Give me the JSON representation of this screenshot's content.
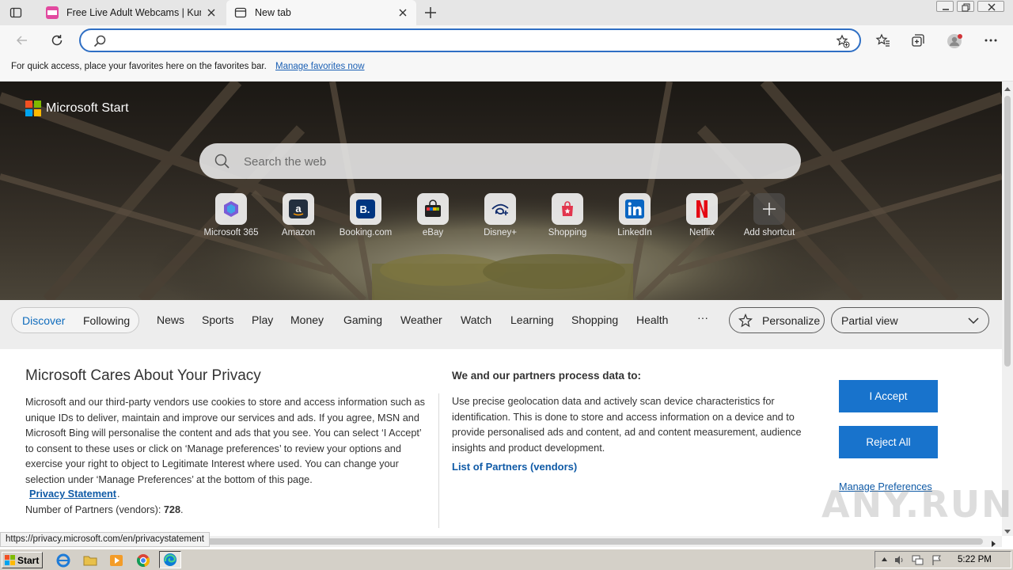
{
  "browser": {
    "tabs": [
      {
        "title": "Free Live Adult Webcams | KumC",
        "active": false
      },
      {
        "title": "New tab",
        "active": true
      }
    ],
    "address": {
      "value": "",
      "placeholder": ""
    },
    "favorites_bar": {
      "text": "For quick access, place your favorites here on the favorites bar.",
      "link": "Manage favorites now"
    },
    "status_url": "https://privacy.microsoft.com/en/privacystatement"
  },
  "page": {
    "brand": "Microsoft Start",
    "search_placeholder": "Search the web",
    "shortcuts": [
      {
        "label": "Microsoft 365",
        "icon": "microsoft-365-icon"
      },
      {
        "label": "Amazon",
        "icon": "amazon-icon"
      },
      {
        "label": "Booking.com",
        "icon": "booking-icon"
      },
      {
        "label": "eBay",
        "icon": "ebay-icon"
      },
      {
        "label": "Disney+",
        "icon": "disney-plus-icon"
      },
      {
        "label": "Shopping",
        "icon": "shopping-icon"
      },
      {
        "label": "LinkedIn",
        "icon": "linkedin-icon"
      },
      {
        "label": "Netflix",
        "icon": "netflix-icon"
      },
      {
        "label": "Add shortcut",
        "icon": "plus-icon"
      }
    ],
    "nav": {
      "discover": "Discover",
      "following": "Following",
      "items": [
        "News",
        "Sports",
        "Play",
        "Money",
        "Gaming",
        "Weather",
        "Watch",
        "Learning",
        "Shopping",
        "Health"
      ],
      "more": "···",
      "personalize": "Personalize",
      "view": "Partial view"
    },
    "consent": {
      "title": "Microsoft Cares About Your Privacy",
      "body": "Microsoft and our third-party vendors use cookies to store and access information such as unique IDs to deliver, maintain and improve our services and ads. If you agree, MSN and Microsoft Bing will personalise the content and ads that you see. You can select ‘I Accept’ to consent to these uses or click on ‘Manage preferences’ to review your options and exercise your right to object to Legitimate Interest where used.  You can change your selection under ‘Manage Preferences’ at the bottom of this page.",
      "privacy_link": "Privacy Statement",
      "privacy_dot": ".",
      "partners_label": "Number of Partners (vendors):",
      "partners_count": "728",
      "partners_dot": ".",
      "subtitle": "We and our partners process data to:",
      "purpose": "Use precise geolocation data and actively scan device characteristics for identification. This is done to store and access information on a device and to provide personalised ads and content, ad and content measurement, audience insights and product development.",
      "vendors_link": "List of Partners (vendors)",
      "accept": "I Accept",
      "reject": "Reject All",
      "manage": "Manage Preferences"
    }
  },
  "watermark": "ANY.RUN",
  "taskbar": {
    "start": "Start",
    "clock": "5:22 PM"
  },
  "colors": {
    "accent": "#1873cc",
    "link": "#0f5aa6",
    "discover": "#0f6cbd",
    "address_border": "#2f6fc4"
  }
}
